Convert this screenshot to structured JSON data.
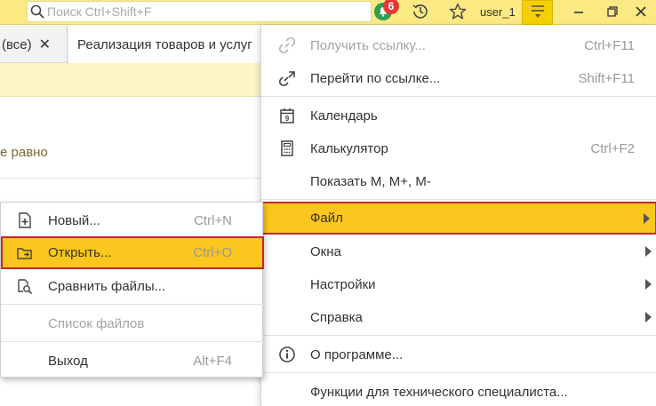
{
  "topbar": {
    "search_placeholder": "Поиск Ctrl+Shift+F",
    "notifications_count": "6",
    "user": "user_1",
    "icons": [
      "search-icon",
      "bell-icon",
      "history-icon",
      "star-icon",
      "menu-icon",
      "minimize-icon",
      "maximize-icon",
      "close-icon"
    ]
  },
  "tabs": [
    {
      "label": "(все)",
      "close": "✕"
    },
    {
      "label": "Реализация товаров и услуг"
    }
  ],
  "content": {
    "text": "е равно"
  },
  "main_menu": {
    "items": [
      {
        "label": "Получить ссылку...",
        "shortcut": "Ctrl+F11",
        "icon": "link-icon",
        "disabled": true
      },
      {
        "label": "Перейти по ссылке...",
        "shortcut": "Shift+F11",
        "icon": "goto-link-icon"
      },
      {
        "label": "Календарь",
        "icon": "calendar-icon",
        "icon_text": "9"
      },
      {
        "label": "Калькулятор",
        "shortcut": "Ctrl+F2",
        "icon": "calculator-icon"
      },
      {
        "label": "Показать M, M+, M-"
      },
      {
        "label": "Файл",
        "submenu": true,
        "active": true
      },
      {
        "label": "Окна",
        "submenu": true
      },
      {
        "label": "Настройки",
        "submenu": true
      },
      {
        "label": "Справка",
        "submenu": true
      },
      {
        "label": "О программе...",
        "icon": "info-icon"
      },
      {
        "label": "Функции для технического специалиста..."
      }
    ]
  },
  "file_submenu": {
    "items": [
      {
        "label": "Новый...",
        "shortcut": "Ctrl+N",
        "icon": "new-file-icon"
      },
      {
        "label": "Открыть...",
        "shortcut": "Ctrl+O",
        "icon": "open-folder-icon",
        "active": true
      },
      {
        "label": "Сравнить файлы...",
        "icon": "compare-files-icon"
      },
      {
        "label": "Список файлов",
        "disabled": true
      },
      {
        "label": "Выход",
        "shortcut": "Alt+F4"
      }
    ]
  },
  "colors": {
    "topbar_bg": "#fbe983",
    "highlight": "#fbc61d",
    "highlight_border": "#c62828",
    "badge": "#e53935",
    "bell": "#2e9e4f"
  }
}
